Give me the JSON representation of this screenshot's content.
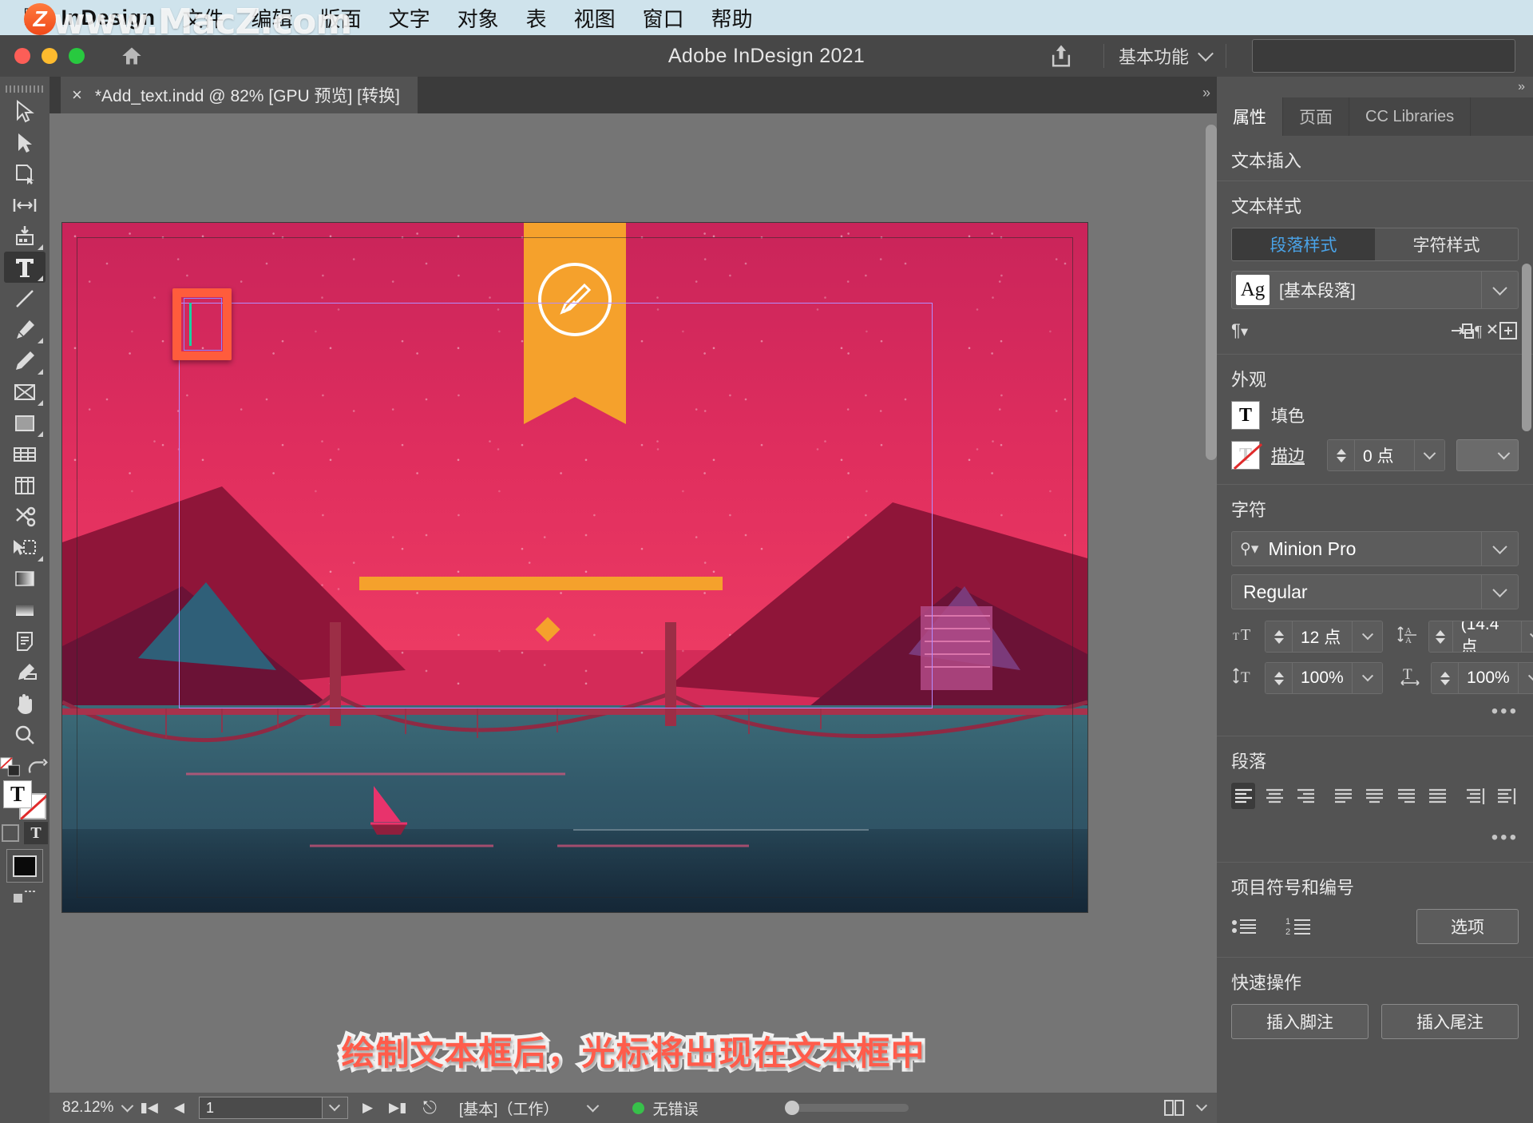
{
  "macmenu": {
    "apple_icon": "apple-icon",
    "app_name": "InDesign",
    "items": [
      "文件",
      "编辑",
      "版面",
      "文字",
      "对象",
      "表",
      "视图",
      "窗口",
      "帮助"
    ]
  },
  "watermark": {
    "text": "www.MacZ.com",
    "badge": "Z"
  },
  "titlebar": {
    "title": "Adobe InDesign 2021",
    "home_icon": "home-icon",
    "share_icon": "share-icon",
    "workspace": "基本功能",
    "search_placeholder": ""
  },
  "doctab": {
    "close_icon": "close-icon",
    "label": "*Add_text.indd @ 82% [GPU 预览] [转换]"
  },
  "toolbar": {
    "tools": [
      {
        "name": "selection-tool",
        "label": "选择工具"
      },
      {
        "name": "direct-selection-tool",
        "label": "直接选择工具"
      },
      {
        "name": "page-tool",
        "label": "页面工具"
      },
      {
        "name": "gap-tool",
        "label": "间隙工具"
      },
      {
        "name": "content-collector-tool",
        "label": "内容收集器工具"
      },
      {
        "name": "type-tool",
        "label": "文字工具"
      },
      {
        "name": "line-tool",
        "label": "直线工具"
      },
      {
        "name": "pen-tool",
        "label": "钢笔工具"
      },
      {
        "name": "pencil-tool",
        "label": "铅笔工具"
      },
      {
        "name": "frame-tool",
        "label": "矩形框架工具"
      },
      {
        "name": "rectangle-tool",
        "label": "矩形工具"
      },
      {
        "name": "table-tool",
        "label": "表格工具"
      },
      {
        "name": "column-tool",
        "label": "栏工具"
      },
      {
        "name": "scissors-tool",
        "label": "剪刀工具"
      },
      {
        "name": "free-transform-tool",
        "label": "自由变换工具"
      },
      {
        "name": "gradient-swatch-tool",
        "label": "渐变色板工具"
      },
      {
        "name": "gradient-feather-tool",
        "label": "渐变羽化工具"
      },
      {
        "name": "note-tool",
        "label": "附注工具"
      },
      {
        "name": "eyedropper-tool",
        "label": "吸管工具"
      },
      {
        "name": "hand-tool",
        "label": "抓手工具"
      },
      {
        "name": "zoom-tool",
        "label": "缩放工具"
      }
    ],
    "selected": "type-tool"
  },
  "canvas": {
    "caption": "绘制文本框后，光标将出现在文本框中",
    "caption_color": "#ff5c4b",
    "highlight_color": "#ff5c3c",
    "page_bg": "#d42b58",
    "accent_orange": "#f5a12c"
  },
  "statusbar": {
    "zoom": "82.12%",
    "first_icon": "first-page-icon",
    "prev_icon": "prev-page-icon",
    "page_value": "1",
    "next_icon": "next-page-icon",
    "last_icon": "last-page-icon",
    "overset_icon": "preflight-icon",
    "master": "[基本]（工作）",
    "status_color": "#37c14a",
    "status_text": "无错误",
    "view_icon": "page-view-icon"
  },
  "rightpanel": {
    "collapse_icon": "collapse-panel-icon",
    "tabs": [
      {
        "label": "属性",
        "name": "tab-properties",
        "active": true
      },
      {
        "label": "页面",
        "name": "tab-pages",
        "active": false
      },
      {
        "label": "CC Libraries",
        "name": "tab-cc-libraries",
        "active": false
      }
    ],
    "text_insert_title": "文本插入",
    "text_style": {
      "title": "文本样式",
      "seg_on": "段落样式",
      "seg_off": "字符样式",
      "ag_badge": "Ag",
      "style_name": "[基本段落]",
      "icons": [
        "paragraph-icon",
        "apply-next-style-icon",
        "clear-overrides-icon",
        "new-style-icon"
      ]
    },
    "appearance": {
      "title": "外观",
      "fill_chip": "T",
      "fill_label": "填色",
      "stroke_chip": "T",
      "stroke_label": "描边",
      "stroke_weight": "0 点",
      "stroke_type": ""
    },
    "character": {
      "title": "字符",
      "font_family": "Minion Pro",
      "font_style": "Regular",
      "size_icon": "font-size-icon",
      "size": "12 点",
      "leading_icon": "leading-icon",
      "leading": "(14.4 点",
      "vscale_icon": "vertical-scale-icon",
      "vscale": "100%",
      "hscale_icon": "horizontal-scale-icon",
      "hscale": "100%",
      "more_icon": "more-options-icon"
    },
    "paragraph": {
      "title": "段落",
      "aligns": [
        {
          "name": "align-left",
          "active": true
        },
        {
          "name": "align-center",
          "active": false
        },
        {
          "name": "align-right",
          "active": false
        },
        {
          "name": "justify-last-left",
          "active": false
        },
        {
          "name": "justify-last-center",
          "active": false
        },
        {
          "name": "justify-last-right",
          "active": false
        },
        {
          "name": "justify-all",
          "active": false
        },
        {
          "name": "align-toward-spine",
          "active": false
        },
        {
          "name": "align-away-spine",
          "active": false
        }
      ],
      "more_icon": "more-options-icon"
    },
    "bullets": {
      "title": "项目符号和编号",
      "bullet_icon": "bulleted-list-icon",
      "number_icon": "numbered-list-icon",
      "options_btn": "选项"
    },
    "quick_actions": {
      "title": "快速操作",
      "footnote_btn": "插入脚注",
      "endnote_btn": "插入尾注"
    }
  }
}
